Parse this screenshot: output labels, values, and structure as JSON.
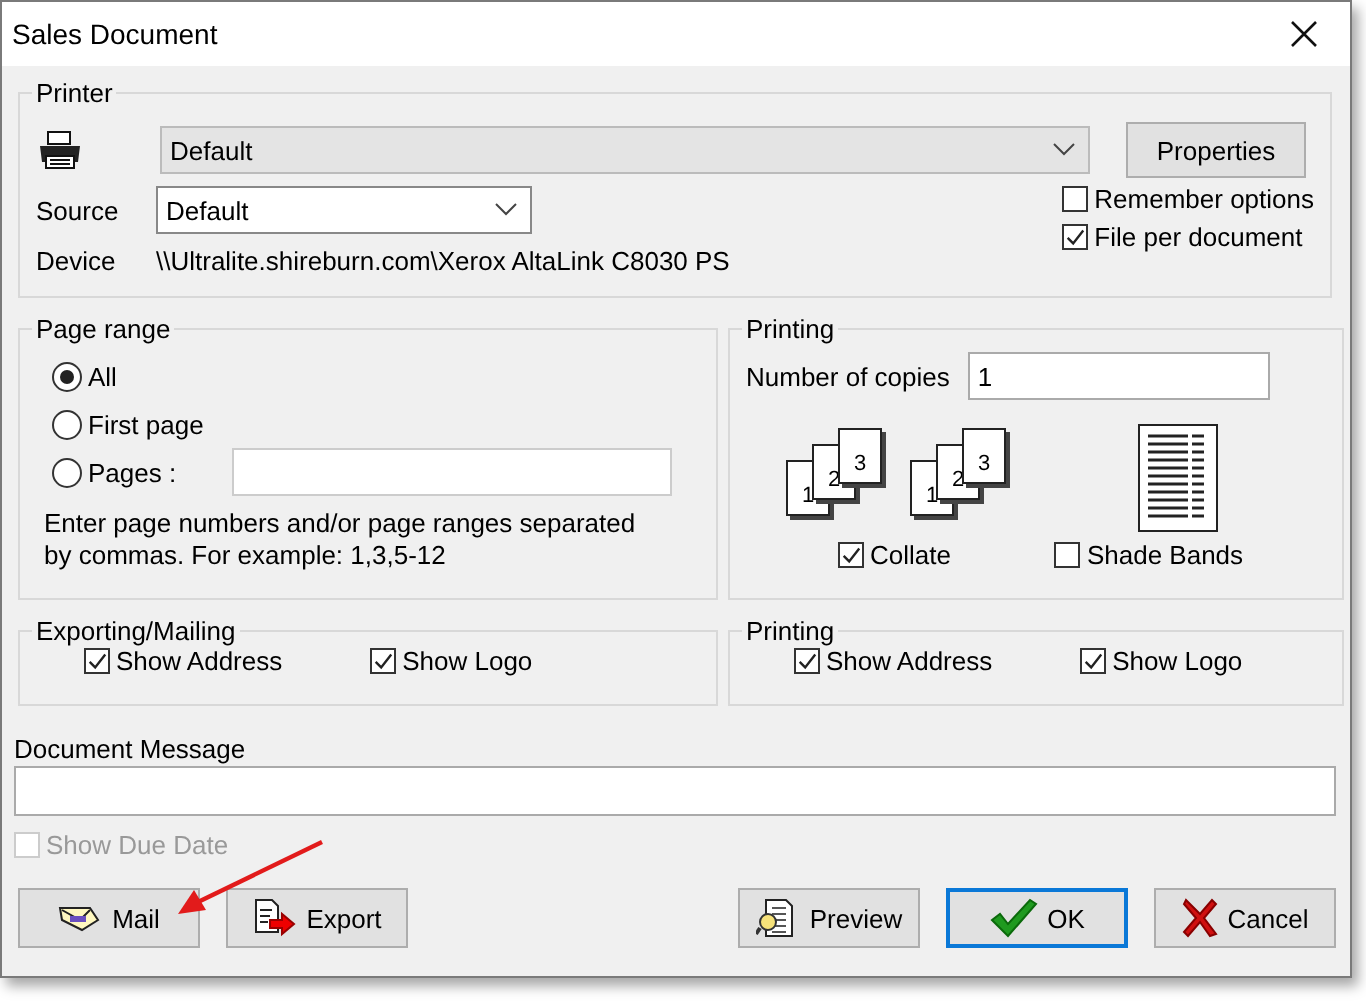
{
  "window": {
    "title": "Sales Document"
  },
  "printer": {
    "legend": "Printer",
    "printer_value": "Default",
    "properties_button": "Properties",
    "source_label": "Source",
    "source_value": "Default",
    "device_label": "Device",
    "device_value": "\\\\Ultralite.shireburn.com\\Xerox AltaLink C8030 PS",
    "options": [
      {
        "label": "Remember options",
        "checked": false
      },
      {
        "label": "File per document",
        "checked": true
      }
    ]
  },
  "page_range": {
    "legend": "Page range",
    "options": [
      {
        "label": "All",
        "selected": true
      },
      {
        "label": "First page",
        "selected": false
      },
      {
        "label": "Pages :",
        "selected": false
      }
    ],
    "hint": "Enter page numbers and/or page ranges separated by commas. For example: 1,3,5-12"
  },
  "printing": {
    "legend": "Printing",
    "copies_label": "Number of copies",
    "copies_value": "1",
    "collate_stacks": [
      [
        "1",
        "2",
        "3"
      ],
      [
        "1",
        "2",
        "3"
      ]
    ],
    "collate": {
      "label": "Collate",
      "checked": true
    },
    "shade_bands": {
      "label": "Shade Bands",
      "checked": false
    }
  },
  "exporting": {
    "legend": "Exporting/Mailing",
    "options": [
      {
        "label": "Show Address",
        "checked": true
      },
      {
        "label": "Show Logo",
        "checked": true
      }
    ]
  },
  "print_options": {
    "legend": "Printing",
    "options": [
      {
        "label": "Show Address",
        "checked": true
      },
      {
        "label": "Show Logo",
        "checked": true
      }
    ]
  },
  "document_message": {
    "label": "Document Message"
  },
  "show_due_date": {
    "label": "Show Due Date",
    "checked": false,
    "disabled": true
  },
  "buttons": [
    {
      "label": "Mail",
      "kind": "mail",
      "default": false
    },
    {
      "label": "Export",
      "kind": "export",
      "default": false
    },
    {
      "label": "Preview",
      "kind": "preview",
      "default": false
    },
    {
      "label": "OK",
      "kind": "ok",
      "default": true
    },
    {
      "label": "Cancel",
      "kind": "cancel",
      "default": false
    }
  ]
}
